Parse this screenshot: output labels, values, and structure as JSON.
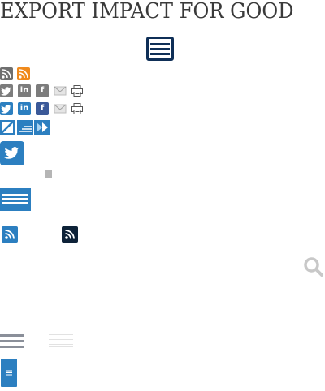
{
  "site": {
    "title": "EXPORT IMPACT FOR GOOD"
  },
  "colors": {
    "title": "#3a3a3a",
    "navy": "#0f2f57",
    "blue": "#2c7fc0",
    "facebook": "#3b5998",
    "rss_orange": "#f08a1c",
    "grey": "#7c7c7c"
  },
  "icons": {
    "row1": [
      "rss-icon",
      "rss-icon"
    ],
    "row2": [
      "twitter-icon",
      "linkedin-icon",
      "facebook-icon",
      "email-icon",
      "print-icon"
    ],
    "row3": [
      "twitter-icon",
      "linkedin-icon",
      "facebook-icon",
      "email-icon",
      "print-icon"
    ],
    "row4": [
      "slash-icon",
      "align-icon",
      "fast-forward-icon"
    ],
    "misc": [
      "twitter-icon",
      "menu-icon",
      "rss-icon",
      "search-icon"
    ]
  }
}
